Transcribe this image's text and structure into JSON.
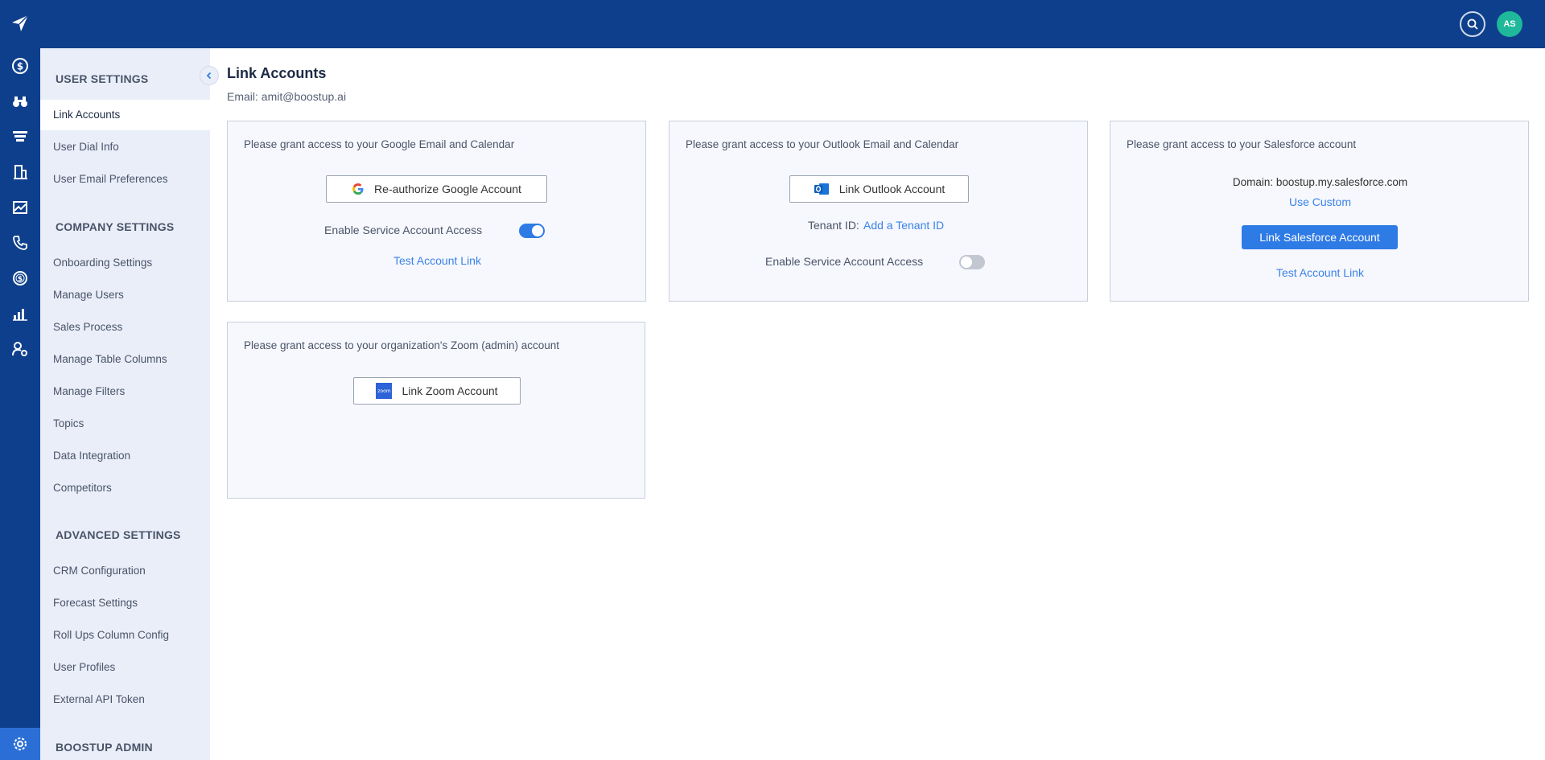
{
  "topbar": {
    "avatar_initials": "AS"
  },
  "sidebar": {
    "user_settings_heading": "USER SETTINGS",
    "user_items": [
      "Link Accounts",
      "User Dial Info",
      "User Email Preferences"
    ],
    "company_settings_heading": "COMPANY SETTINGS",
    "company_items": [
      "Onboarding Settings",
      "Manage Users",
      "Sales Process",
      "Manage Table Columns",
      "Manage Filters",
      "Topics",
      "Data Integration",
      "Competitors"
    ],
    "advanced_settings_heading": "ADVANCED SETTINGS",
    "advanced_items": [
      "CRM Configuration",
      "Forecast Settings",
      "Roll Ups Column Config",
      "User Profiles",
      "External API Token"
    ],
    "boostup_admin_heading": "BOOSTUP ADMIN",
    "active_item": "Link Accounts"
  },
  "page": {
    "title": "Link Accounts",
    "email": "Email: amit@boostup.ai"
  },
  "google": {
    "description": "Please grant access to your Google Email and Calendar",
    "button_label": "Re-authorize Google Account",
    "service_access_label": "Enable Service Account Access",
    "service_access_enabled": true,
    "test_link": "Test Account Link"
  },
  "outlook": {
    "description": "Please grant access to your Outlook Email and Calendar",
    "button_label": "Link Outlook Account",
    "tenant_label": "Tenant ID:",
    "tenant_link": "Add a Tenant ID",
    "service_access_label": "Enable Service Account Access",
    "service_access_enabled": false
  },
  "salesforce": {
    "description": "Please grant access to your Salesforce account",
    "domain_text": "Domain: boostup.my.salesforce.com",
    "use_custom_link": "Use Custom",
    "button_label": "Link Salesforce Account",
    "test_link": "Test Account Link"
  },
  "zoom": {
    "description": "Please grant access to your organization's Zoom (admin) account",
    "button_label": "Link Zoom Account",
    "icon_text": "zoom"
  },
  "icons": {
    "rail": [
      "paper-plane-logo-icon",
      "dollar-circle-icon",
      "binoculars-icon",
      "funnel-icon",
      "building-icon",
      "chart-image-icon",
      "phone-icon",
      "dollar-target-icon",
      "bar-chart-icon",
      "user-settings-icon",
      "gear-icon"
    ]
  },
  "colors": {
    "header": "#0e3f8c",
    "primary": "#2f7be6",
    "sidebar_bg": "#e9eef9",
    "avatar": "#1fb89a"
  }
}
